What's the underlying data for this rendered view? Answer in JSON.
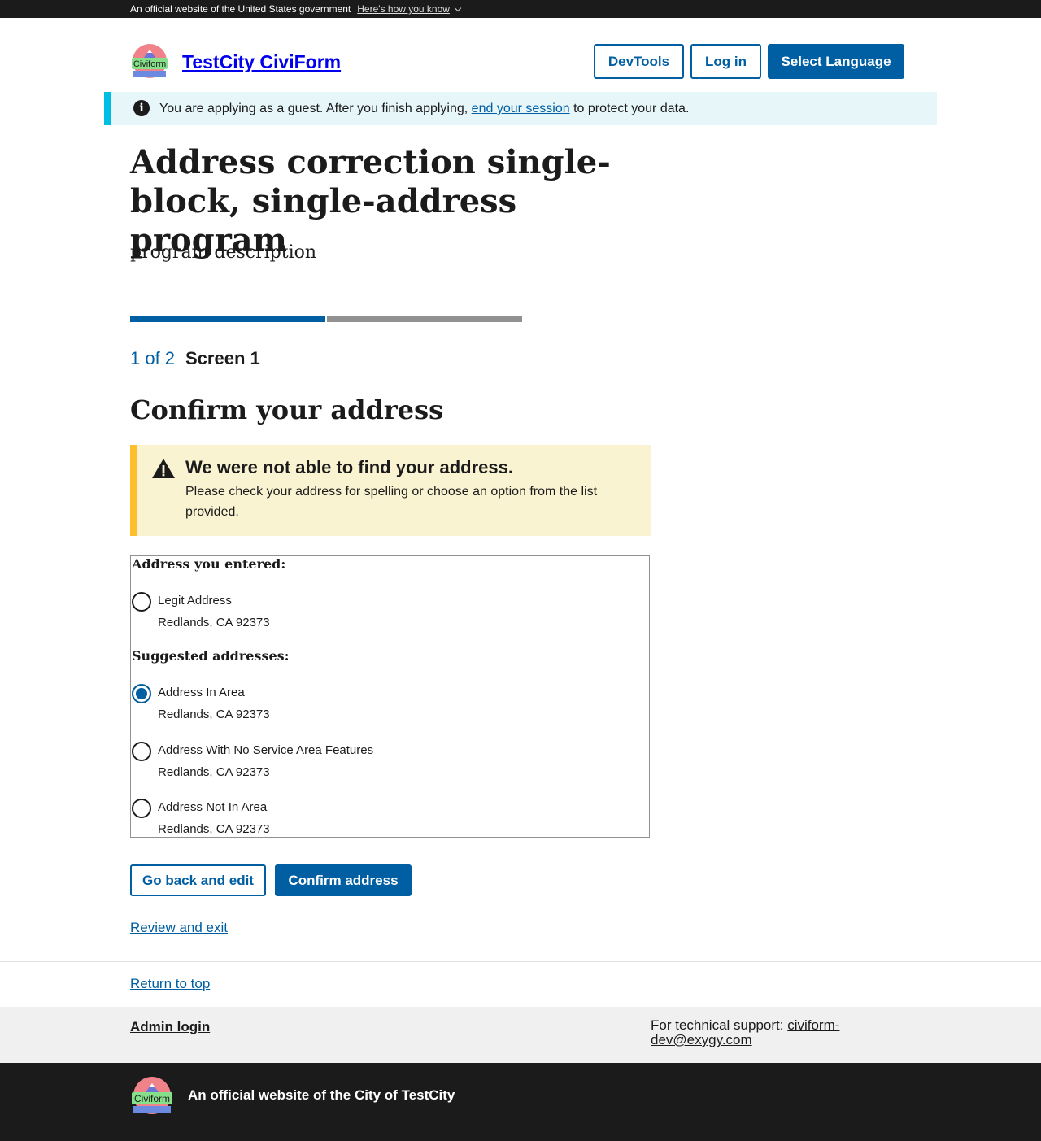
{
  "gov_banner": {
    "official_text": "An official website of the United States government",
    "how_label": "Here's how you know"
  },
  "header": {
    "logo_text": "Civiform",
    "site_title": "TestCity CiviForm",
    "devtools_label": "DevTools",
    "login_label": "Log in",
    "language_label": "Select Language"
  },
  "guest_alert": {
    "text_before": "You are applying as a guest. After you finish applying,",
    "link_text": "end your session",
    "text_after": "to protect your data."
  },
  "program": {
    "title": "Address correction single-block, single-address program",
    "description": "program description"
  },
  "progress": {
    "current": 1,
    "total": 2,
    "count_text": "1 of 2",
    "screen_name": "Screen 1"
  },
  "confirm_heading": "Confirm your address",
  "warning": {
    "title": "We were not able to find your address.",
    "body": "Please check your address for spelling or choose an option from the list provided."
  },
  "entered_group": {
    "title": "Address you entered:",
    "options": [
      {
        "line1": "Legit Address",
        "line2": "Redlands, CA 92373",
        "selected": false
      }
    ]
  },
  "suggested_group": {
    "title": "Suggested addresses:",
    "options": [
      {
        "line1": "Address In Area",
        "line2": "Redlands, CA 92373",
        "selected": true
      },
      {
        "line1": "Address With No Service Area Features",
        "line2": "Redlands, CA 92373",
        "selected": false
      },
      {
        "line1": "Address Not In Area",
        "line2": "Redlands, CA 92373",
        "selected": false
      }
    ]
  },
  "actions": {
    "back_label": "Go back and edit",
    "confirm_label": "Confirm address",
    "review_label": "Review and exit"
  },
  "footer": {
    "return_top": "Return to top",
    "admin_login": "Admin login",
    "support_label": "For technical support:",
    "support_email": "civiform-dev@exygy.com",
    "official_city": "An official website of the City of TestCity",
    "logo_text": "Civiform"
  },
  "colors": {
    "primary": "#005ea2",
    "warning_border": "#ffbe2e",
    "warning_bg": "#faf3d1",
    "info_border": "#00bde3",
    "info_bg": "#e7f6f8",
    "dark": "#1b1b1b"
  },
  "icons": [
    "chevron-down-icon",
    "info-icon",
    "warning-icon",
    "civiform-logo"
  ]
}
